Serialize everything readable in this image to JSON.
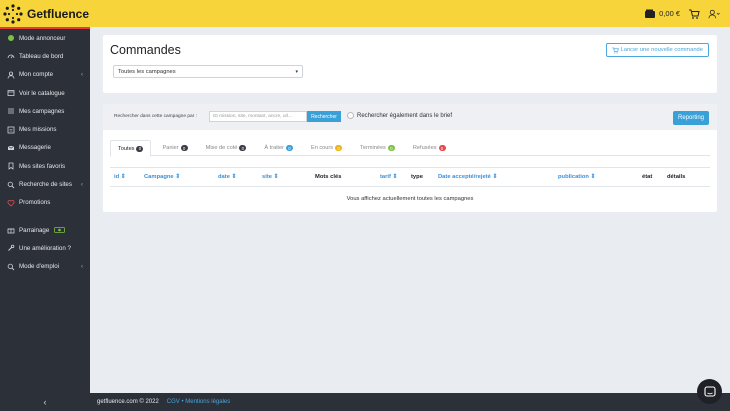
{
  "app": {
    "name": "Getfluence"
  },
  "topbar": {
    "balance": "0,00 €"
  },
  "sidebar": {
    "items": [
      {
        "label": "Mode annonceur",
        "icon": "green-dot-icon"
      },
      {
        "label": "Tableau de bord",
        "icon": "dashboard-icon"
      },
      {
        "label": "Mon compte",
        "icon": "user-icon",
        "chevron": "‹"
      },
      {
        "label": "Voir le catalogue",
        "icon": "catalogue-icon"
      },
      {
        "label": "Mes campagnes",
        "icon": "list-icon"
      },
      {
        "label": "Mes missions",
        "icon": "missions-icon"
      },
      {
        "label": "Messagerie",
        "icon": "message-icon"
      },
      {
        "label": "Mes sites favoris",
        "icon": "bookmark-icon"
      },
      {
        "label": "Recherche de sites",
        "icon": "search-icon",
        "chevron": "‹"
      },
      {
        "label": "Promotions",
        "icon": "heart-icon"
      }
    ],
    "items2": [
      {
        "label": "Parrainage",
        "icon": "gift-icon"
      },
      {
        "label": "Une amélioration ?",
        "icon": "wrench-icon"
      },
      {
        "label": "Mode d'emploi",
        "icon": "search-icon",
        "chevron": "‹"
      }
    ],
    "collapse_glyph": "‹"
  },
  "header": {
    "title": "Commandes",
    "new_order_label": "Lancer une nouvelle commande",
    "campaign_select": "Toutes les campagnes"
  },
  "search": {
    "label": "Rechercher dans cette campagne par :",
    "placeholder": "ID mission, site, montant, ancre, url...",
    "button": "Rechercher",
    "brief_label": "Rechercher également dans le brief",
    "reporting": "Reporting"
  },
  "tabs": [
    {
      "label": "Toutes",
      "count": "0",
      "color": "#3a3d44"
    },
    {
      "label": "Panier",
      "count": "0",
      "color": "#3a3d44"
    },
    {
      "label": "Mise de coté",
      "count": "0",
      "color": "#3a3d44"
    },
    {
      "label": "À traiter",
      "count": "0",
      "color": "#3aa0d8"
    },
    {
      "label": "En cours",
      "count": "0",
      "color": "#e8b21f"
    },
    {
      "label": "Terminées",
      "count": "0",
      "color": "#7bc242"
    },
    {
      "label": "Refusées",
      "count": "0",
      "color": "#e34b4b"
    }
  ],
  "table": {
    "columns": [
      {
        "label": "id ⇕",
        "sortable": true
      },
      {
        "label": "Campagne ⇕",
        "sortable": true
      },
      {
        "label": "date ⇕",
        "sortable": true
      },
      {
        "label": "site ⇕",
        "sortable": true
      },
      {
        "label": "Mots clés",
        "sortable": false
      },
      {
        "label": "tarif ⇕",
        "sortable": true
      },
      {
        "label": "type",
        "sortable": false
      },
      {
        "label": "Date accepté/rejeté ⇕",
        "sortable": true
      },
      {
        "label": "publication ⇕",
        "sortable": true
      },
      {
        "label": "état",
        "sortable": false
      },
      {
        "label": "détails",
        "sortable": false
      }
    ],
    "empty_message": "Vous affichez actuellement toutes les campagnes"
  },
  "footer": {
    "copyright": "getfluence.com © 2022",
    "links": "CGV • Mentions légales"
  }
}
